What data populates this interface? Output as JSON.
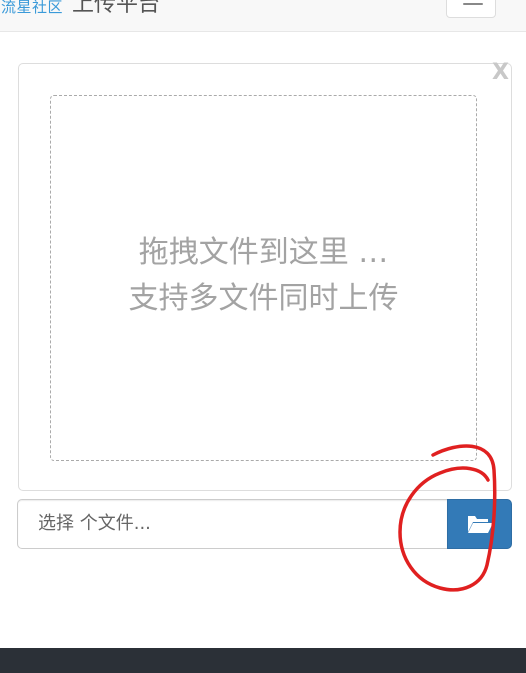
{
  "navbar": {
    "brand_logo": "流星社区",
    "brand_title": "上传平台"
  },
  "upload": {
    "close_label": "X",
    "drop_line1": "拖拽文件到这里 …",
    "drop_line2": "支持多文件同时上传",
    "caption_placeholder": "选择 个文件..."
  },
  "icons": {
    "browse": "folder-open-icon",
    "menu": "hamburger-menu-icon"
  },
  "colors": {
    "primary": "#337ab7",
    "annotation": "#e02020",
    "footer": "#2b3037"
  }
}
